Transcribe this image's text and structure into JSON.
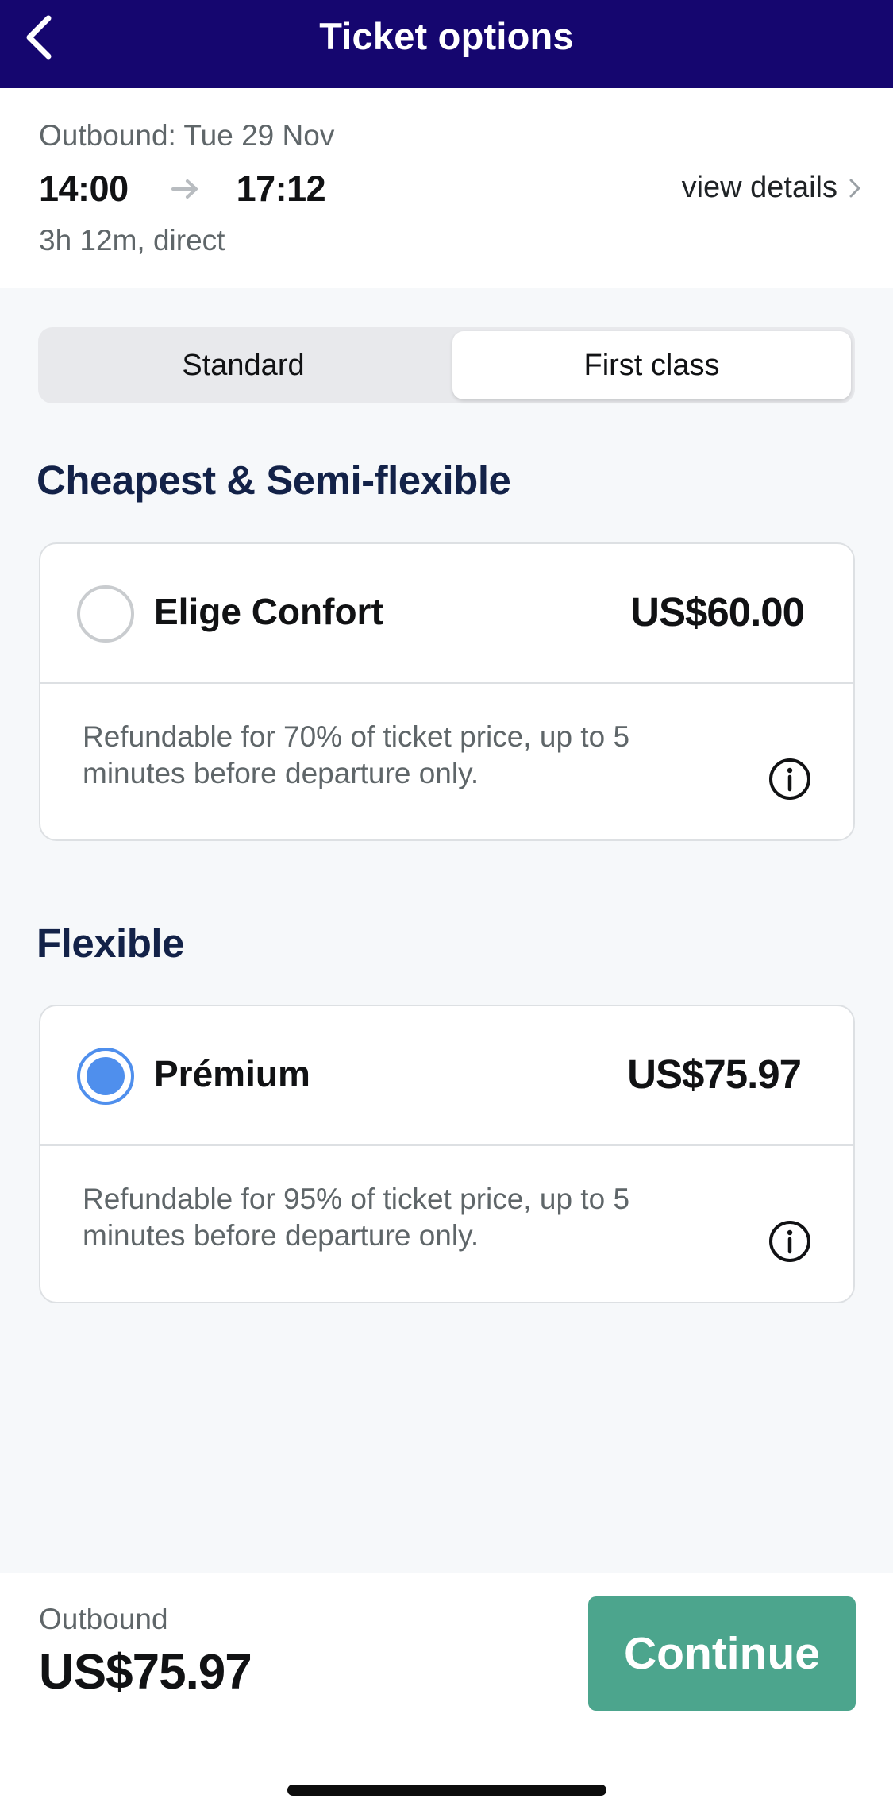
{
  "header": {
    "title": "Ticket options",
    "back_icon": "chevron-left-icon",
    "background": "#15066f"
  },
  "journey": {
    "outbound_label": "Outbound: Tue 29 Nov",
    "depart_time": "14:00",
    "arrive_time": "17:12",
    "duration": "3h 12m, direct",
    "details_label": "view details",
    "arrow_icon": "arrow-right-icon",
    "details_icon": "chevron-right-icon"
  },
  "class_tabs": [
    {
      "label": "Standard",
      "selected": false
    },
    {
      "label": "First class",
      "selected": true
    }
  ],
  "sections": [
    {
      "title": "Cheapest & Semi-flexible",
      "fare": {
        "name": "Elige Confort",
        "price": "US$60.00",
        "selected": false,
        "description": "Refundable for 70% of ticket price, up to 5 minutes before departure only."
      }
    },
    {
      "title": "Flexible",
      "fare": {
        "name": "Prémium",
        "price": "US$75.97",
        "selected": true,
        "description": "Refundable for 95% of ticket price, up to 5 minutes before departure only."
      }
    }
  ],
  "footer": {
    "label": "Outbound",
    "total": "US$75.97",
    "continue_label": "Continue",
    "continue_color": "#4ca58d"
  },
  "colors": {
    "selected_radio": "#4f8fed",
    "section_title": "#132248"
  }
}
